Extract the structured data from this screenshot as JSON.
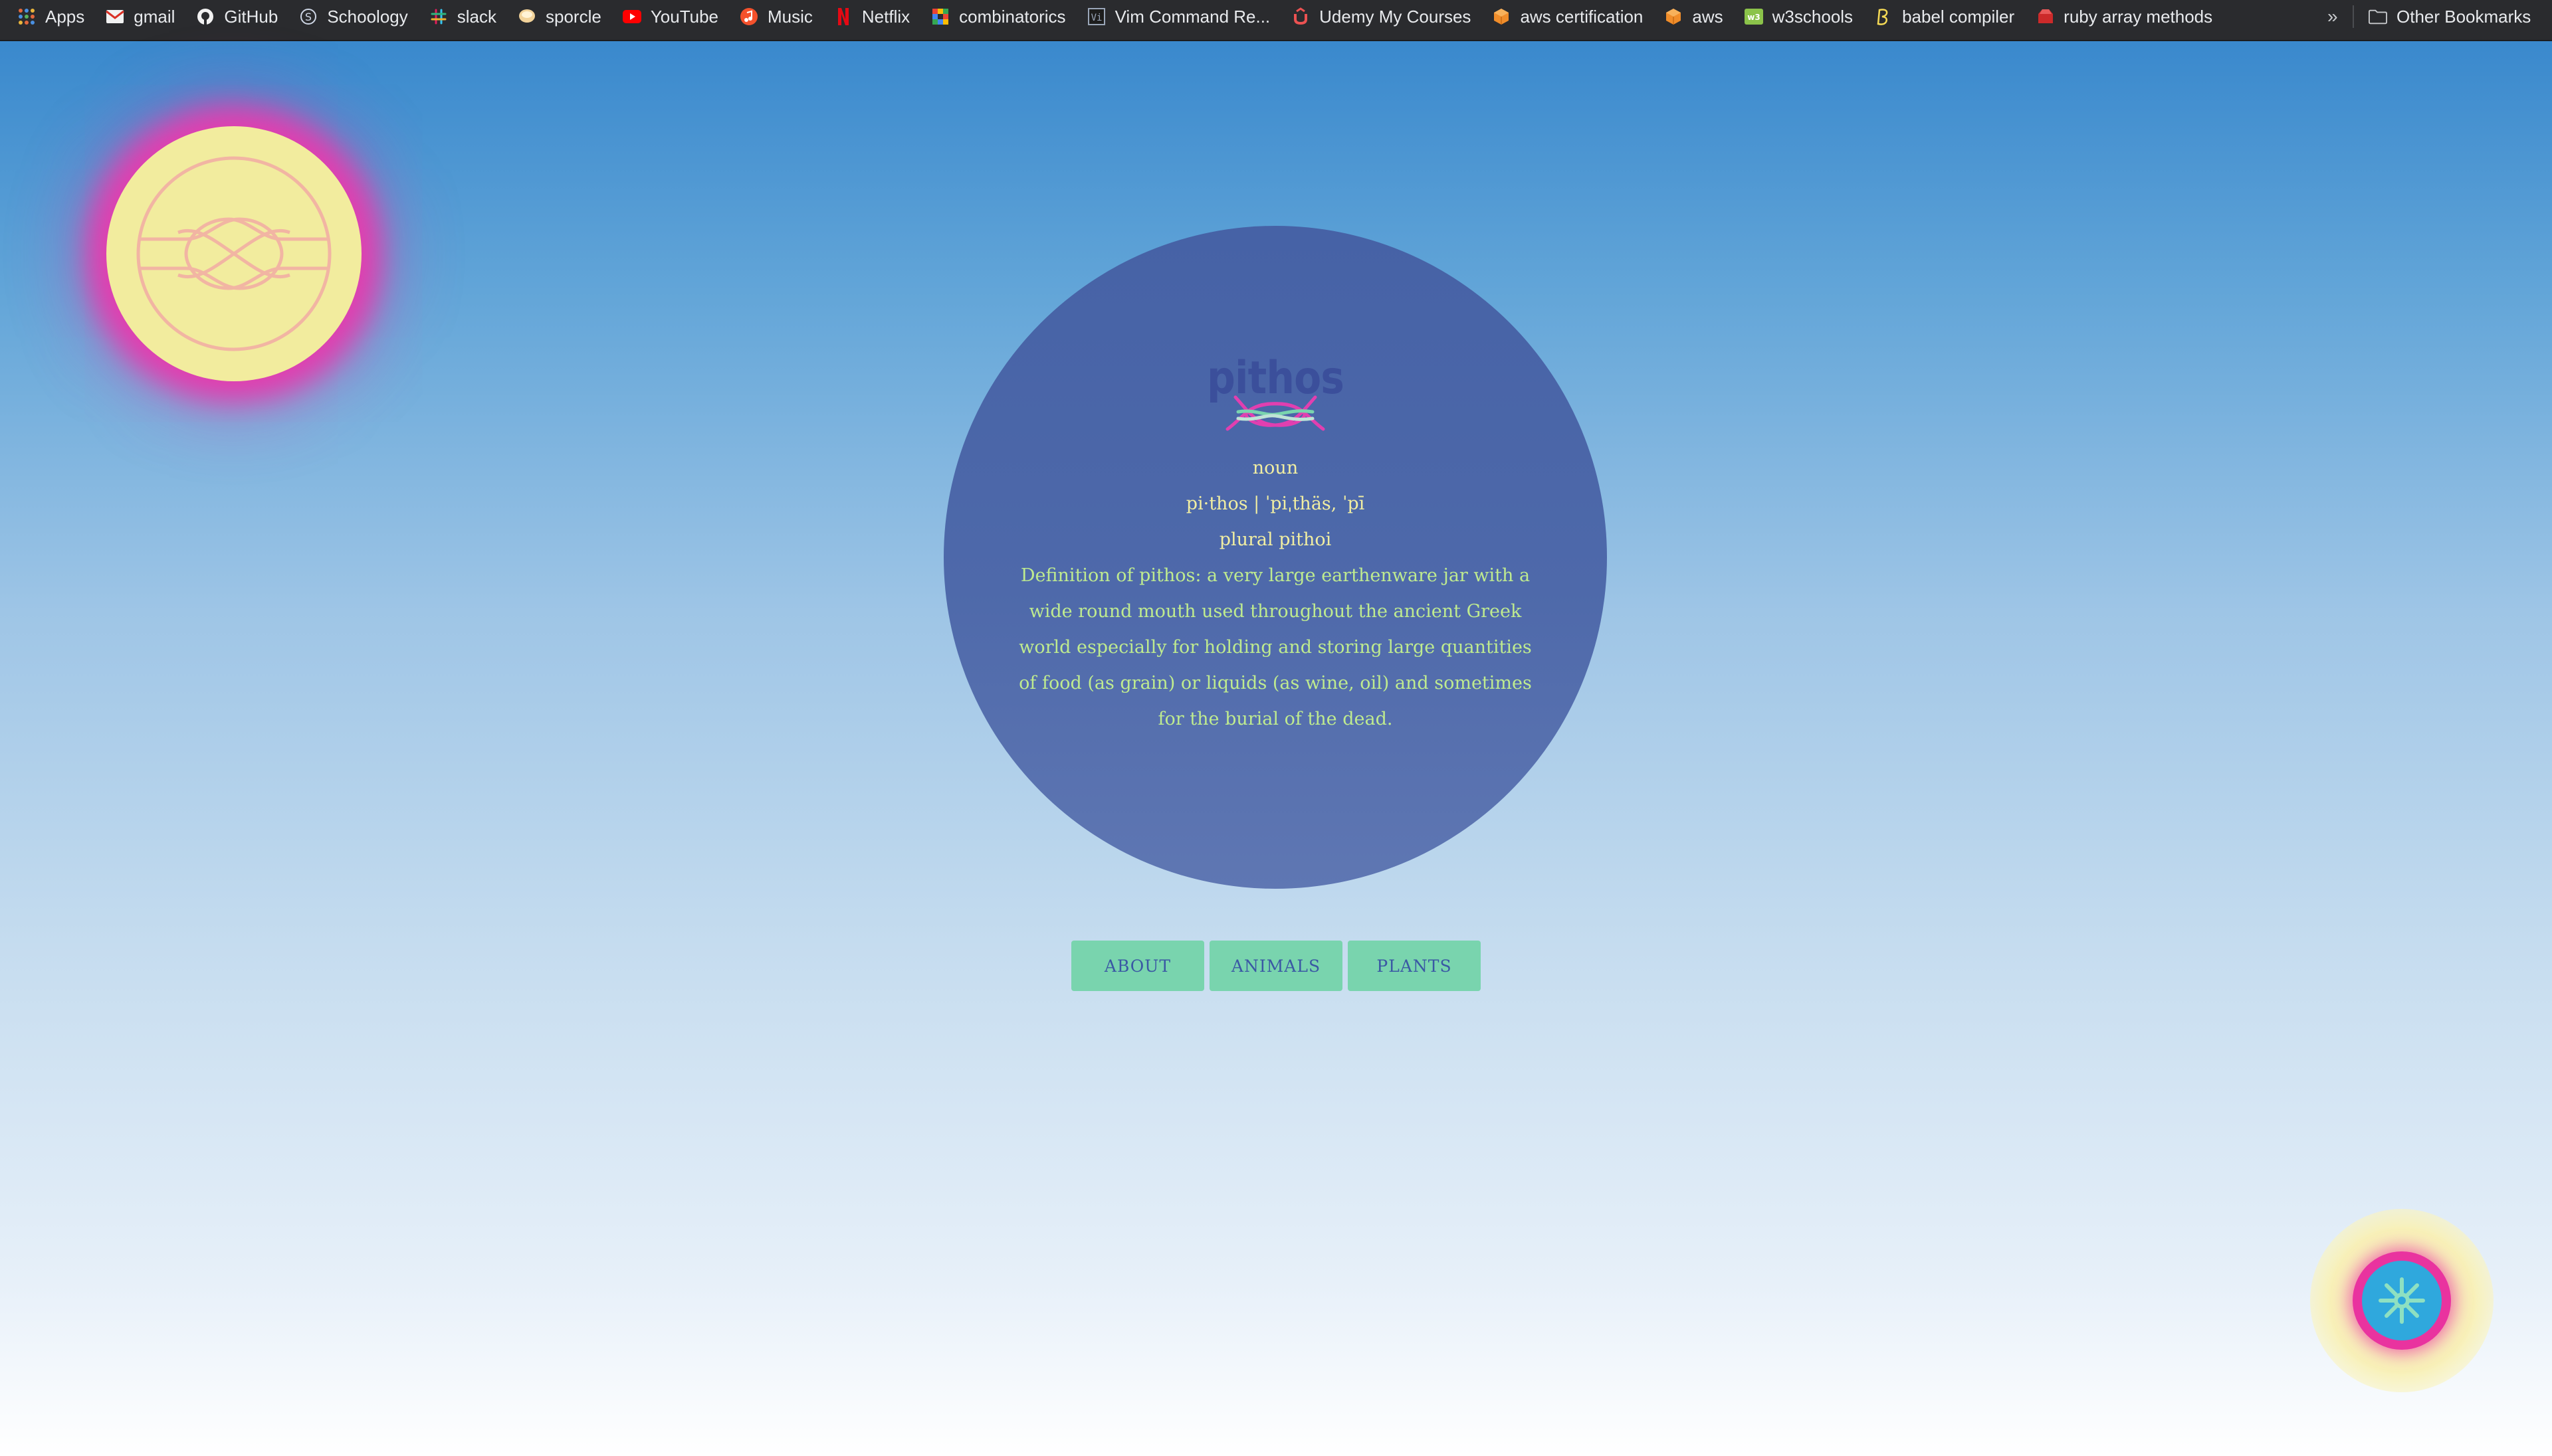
{
  "bookmarks": {
    "items": [
      {
        "label": "Apps",
        "icon": "apps-grid-icon"
      },
      {
        "label": "gmail",
        "icon": "gmail-icon"
      },
      {
        "label": "GitHub",
        "icon": "github-icon"
      },
      {
        "label": "Schoology",
        "icon": "schoology-icon"
      },
      {
        "label": "slack",
        "icon": "slack-icon"
      },
      {
        "label": "sporcle",
        "icon": "sporcle-icon"
      },
      {
        "label": "YouTube",
        "icon": "youtube-icon"
      },
      {
        "label": "Music",
        "icon": "music-icon"
      },
      {
        "label": "Netflix",
        "icon": "netflix-icon"
      },
      {
        "label": "combinatorics",
        "icon": "combinatorics-icon"
      },
      {
        "label": "Vim Command Re...",
        "icon": "vim-icon"
      },
      {
        "label": "Udemy My Courses",
        "icon": "udemy-icon"
      },
      {
        "label": "aws certification",
        "icon": "aws-cube-icon"
      },
      {
        "label": "aws",
        "icon": "aws-cube-icon"
      },
      {
        "label": "w3schools",
        "icon": "w3schools-icon"
      },
      {
        "label": "babel compiler",
        "icon": "babel-icon"
      },
      {
        "label": "ruby array methods",
        "icon": "ruby-icon"
      }
    ],
    "overflow": "»",
    "other": "Other Bookmarks"
  },
  "entry": {
    "word": "pithos",
    "part_of_speech": "noun",
    "pronunciation": "pi·thos | ˈpiˌthäs, ˈpī",
    "plural": "plural pithoi",
    "definition": "Definition of pithos: a very large earthenware jar with a wide round mouth used throughout the ancient Greek world especially for holding and storing large quantities of food (as grain) or liquids (as wine, oil) and sometimes for the burial of the dead."
  },
  "nav": {
    "about": "ABOUT",
    "animals": "ANIMALS",
    "plants": "PLANTS"
  },
  "colors": {
    "circle": "#4662a6",
    "button": "#79d4ae",
    "sun": "#f2ec9e",
    "glow": "#e13fb0",
    "definition_text": "#bfeb8f",
    "header_text": "#f1eea2"
  }
}
